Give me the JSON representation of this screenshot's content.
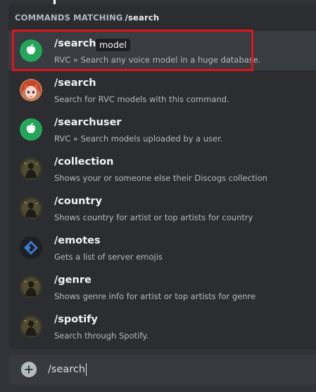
{
  "autocomplete": {
    "header_label": "COMMANDS MATCHING",
    "header_query": "/search",
    "commands": [
      {
        "name": "/search",
        "option": "model",
        "description": "RVC » Search any voice model in a huge database.",
        "avatar_icon": "apple-logo-icon",
        "selected": true
      },
      {
        "name": "/search",
        "description": "Search for RVC models with this command.",
        "avatar_icon": "anime-character-avatar-icon"
      },
      {
        "name": "/searchuser",
        "description": "RVC » Search models uploaded by a user.",
        "avatar_icon": "apple-logo-icon"
      },
      {
        "name": "/collection",
        "description": "Shows your or someone else their Discogs collection",
        "avatar_icon": "dark-figure-avatar-icon"
      },
      {
        "name": "/country",
        "description": "Shows country for artist or top artists for country",
        "avatar_icon": "dark-figure-avatar-icon"
      },
      {
        "name": "/emotes",
        "description": "Gets a list of server emojis",
        "avatar_icon": "blue-diamond-logo-icon"
      },
      {
        "name": "/genre",
        "description": "Shows genre info for artist or top artists for genre",
        "avatar_icon": "dark-figure-avatar-icon"
      },
      {
        "name": "/spotify",
        "description": "Search through Spotify.",
        "avatar_icon": "dark-figure-avatar-icon"
      }
    ]
  },
  "chat_input": {
    "value": "/search",
    "attach_icon": "plus-circle-icon"
  },
  "colors": {
    "background": "#313338",
    "popup": "#2b2d31",
    "selected_row": "#393c41",
    "highlight_border": "#e0161b",
    "apple_green": "#23a55a",
    "emotes_blue": "#3b7bd6"
  }
}
